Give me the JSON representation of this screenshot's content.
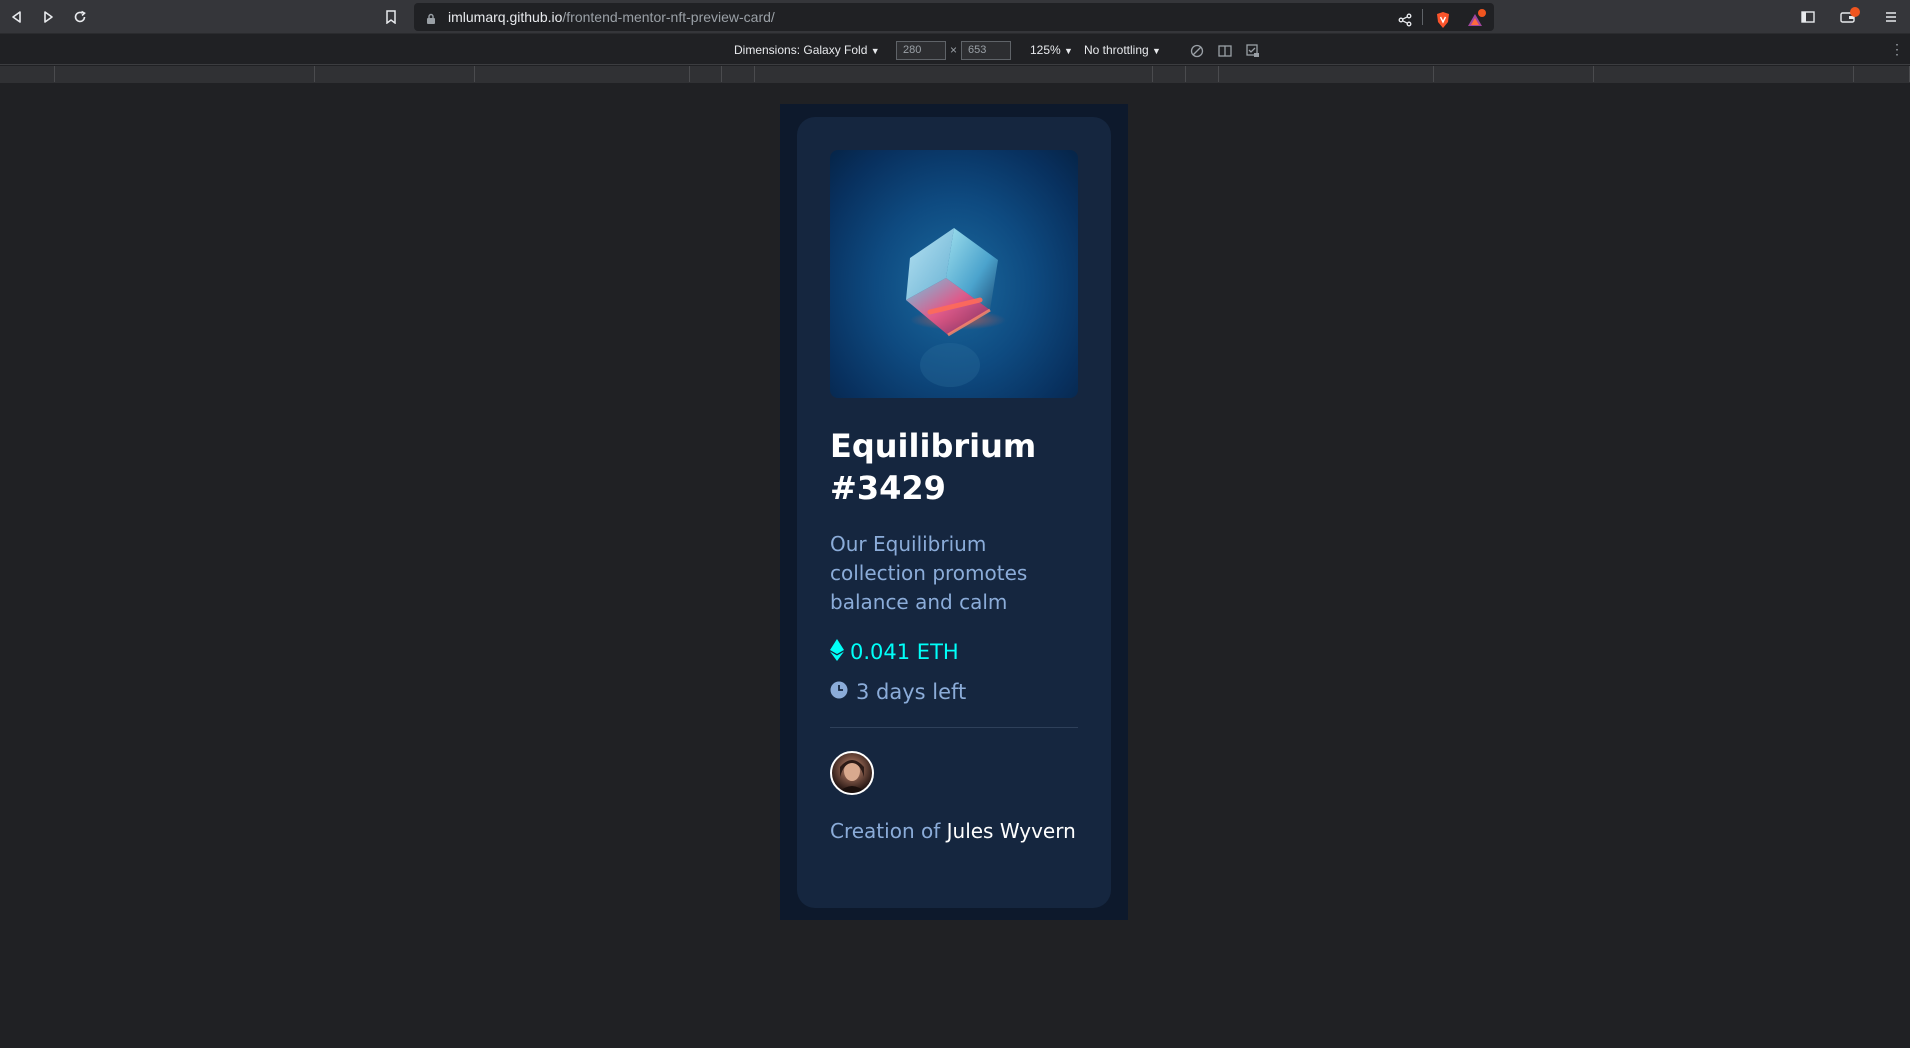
{
  "browser": {
    "url_host": "imlumarq.github.io",
    "url_path": "/frontend-mentor-nft-preview-card/",
    "icons": [
      "back-icon",
      "forward-icon",
      "reload-icon",
      "bookmark-icon",
      "lock-icon",
      "share-icon",
      "brave-shield-icon",
      "brave-rewards-icon",
      "sidebar-icon",
      "wallet-icon",
      "menu-icon"
    ]
  },
  "devtools": {
    "dimensions_label": "Dimensions: Galaxy Fold",
    "width_value": "280",
    "times": "×",
    "height_value": "653",
    "zoom": "125%",
    "throttling": "No throttling",
    "dropdown_arrow": "▼",
    "more": "⋮"
  },
  "card": {
    "title": "Equilibrium #3429",
    "description": "Our Equilibrium collection promotes balance and calm",
    "price": "0.041 ETH",
    "time_left": "3 days left",
    "creator_prefix": "Creation of",
    "creator_name": "Jules Wyvern"
  },
  "colors": {
    "page_bg": "#0d192c",
    "card_bg": "#15263f",
    "accent_cyan": "#00fff8",
    "soft_blue": "#8bacd9",
    "white": "#ffffff"
  }
}
